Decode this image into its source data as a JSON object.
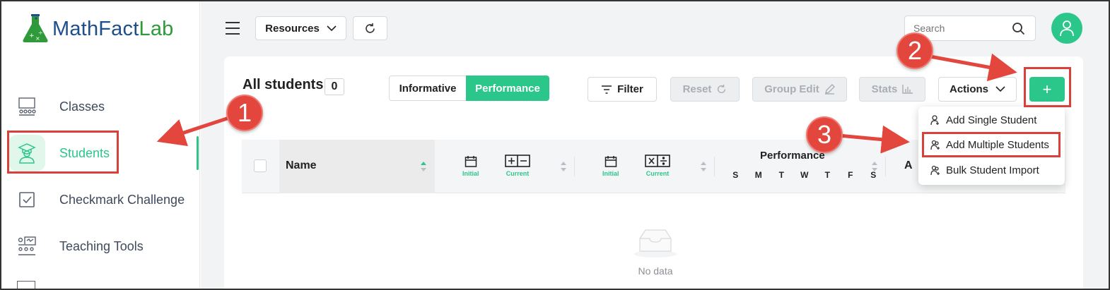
{
  "brand": {
    "part1": "MathFact",
    "part2": "Lab"
  },
  "sidebar": {
    "items": [
      {
        "label": "Classes",
        "icon": "classroom-icon"
      },
      {
        "label": "Students",
        "icon": "student-icon",
        "active": true
      },
      {
        "label": "Checkmark Challenge",
        "icon": "checkbox-icon"
      },
      {
        "label": "Teaching Tools",
        "icon": "teaching-tools-icon"
      }
    ]
  },
  "topbar": {
    "resources_label": "Resources",
    "search_placeholder": "Search"
  },
  "page": {
    "title": "All students",
    "count": "0",
    "view_toggle": [
      "Informative",
      "Performance"
    ],
    "active_view": "Performance",
    "buttons": {
      "filter": "Filter",
      "reset": "Reset",
      "group_edit": "Group Edit",
      "stats": "Stats",
      "actions": "Actions",
      "add": "+"
    }
  },
  "table": {
    "name_header": "Name",
    "col1": {
      "initial": "Initial",
      "current": "Current"
    },
    "col2": {
      "initial": "Initial",
      "current": "Current"
    },
    "performance_header": "Performance",
    "days": [
      "S",
      "M",
      "T",
      "W",
      "T",
      "F",
      "S"
    ],
    "partial_header": "A",
    "empty_text": "No data"
  },
  "actions_menu": {
    "items": [
      "Add Single Student",
      "Add Multiple Students",
      "Bulk Student Import"
    ]
  },
  "annotations": {
    "badges": [
      "1",
      "2",
      "3"
    ],
    "color": "#e2463c"
  },
  "colors": {
    "accent": "#2bc78a",
    "logo_blue": "#1e4e8c",
    "logo_green": "#2e9a3a"
  }
}
